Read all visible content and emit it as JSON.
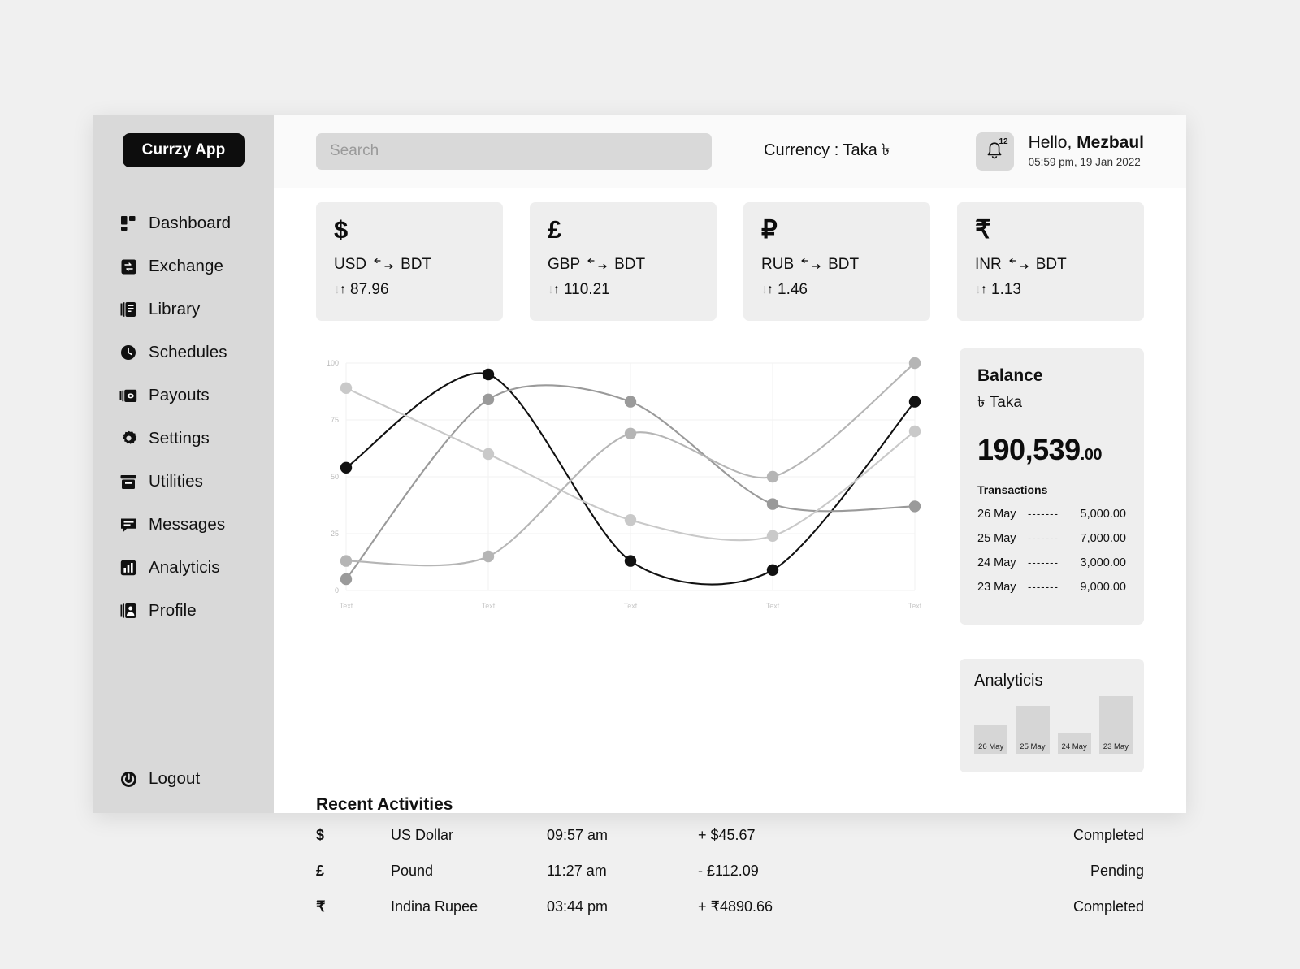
{
  "brand": {
    "name": "Currzy App"
  },
  "sidebar": {
    "items": [
      {
        "label": "Dashboard",
        "icon": "dashboard-icon"
      },
      {
        "label": "Exchange",
        "icon": "exchange-icon"
      },
      {
        "label": "Library",
        "icon": "library-icon"
      },
      {
        "label": "Schedules",
        "icon": "clock-icon"
      },
      {
        "label": "Payouts",
        "icon": "money-icon"
      },
      {
        "label": "Settings",
        "icon": "gear-icon"
      },
      {
        "label": "Utilities",
        "icon": "archive-icon"
      },
      {
        "label": "Messages",
        "icon": "chat-icon"
      },
      {
        "label": "Analyticis",
        "icon": "bar-chart-icon"
      },
      {
        "label": "Profile",
        "icon": "profile-icon"
      }
    ],
    "logout": {
      "label": "Logout",
      "icon": "power-icon"
    }
  },
  "topbar": {
    "search_placeholder": "Search",
    "search_value": "",
    "currency_label": "Currency : Taka ৳",
    "notifications_count": "12",
    "greeting_prefix": "Hello, ",
    "user_name": "Mezbaul",
    "datetime": "05:59 pm, 19 Jan 2022"
  },
  "rate_cards": [
    {
      "symbol": "$",
      "from": "USD",
      "arrow": "↔",
      "to": "BDT",
      "value": "87.96"
    },
    {
      "symbol": "£",
      "from": "GBP",
      "arrow": "↔",
      "to": "BDT",
      "value": "110.21"
    },
    {
      "symbol": "₽",
      "from": "RUB",
      "arrow": "↔",
      "to": "BDT",
      "value": "1.46"
    },
    {
      "symbol": "₹",
      "from": "INR",
      "arrow": "↔",
      "to": "BDT",
      "value": "1.13"
    }
  ],
  "chart_data": {
    "type": "line",
    "title": "",
    "xlabel": "",
    "ylabel": "",
    "ylim": [
      0,
      100
    ],
    "yticks": [
      0,
      25,
      50,
      75,
      100
    ],
    "grid": true,
    "legend": "none",
    "categories": [
      "Text",
      "Text",
      "Text",
      "Text",
      "Text"
    ],
    "series": [
      {
        "name": "series-dark",
        "color": "#111111",
        "values": [
          54,
          95,
          13,
          9,
          83
        ]
      },
      {
        "name": "series-mid-gray",
        "color": "#9a9a9a",
        "values": [
          5,
          84,
          83,
          38,
          37
        ]
      },
      {
        "name": "series-light-gray",
        "color": "#c9c9c9",
        "values": [
          89,
          60,
          31,
          24,
          70
        ]
      },
      {
        "name": "series-pale-gray",
        "color": "#b5b5b5",
        "values": [
          13,
          15,
          69,
          50,
          100
        ]
      }
    ]
  },
  "balance": {
    "title": "Balance",
    "currency_symbol": "৳",
    "currency_name": "Taka",
    "amount_main": "190,539",
    "amount_cents": ".00",
    "transactions_title": "Transactions",
    "dash": "-------",
    "transactions": [
      {
        "date": "26 May",
        "amount": "5,000.00"
      },
      {
        "date": "25 May",
        "amount": "7,000.00"
      },
      {
        "date": "24 May",
        "amount": "3,000.00"
      },
      {
        "date": "23 May",
        "amount": "9,000.00"
      }
    ]
  },
  "activities": {
    "title": "Recent Activities",
    "rows": [
      {
        "symbol": "$",
        "name": "US Dollar",
        "time": "09:57 am",
        "amount": "+ $45.67",
        "status": "Completed"
      },
      {
        "symbol": "£",
        "name": "Pound",
        "time": "11:27 am",
        "amount": "- £112.09",
        "status": "Pending"
      },
      {
        "symbol": "₹",
        "name": "Indina Rupee",
        "time": "03:44 pm",
        "amount": "+ ₹4890.66",
        "status": "Completed"
      }
    ]
  },
  "analytics": {
    "title": "Analyticis",
    "chart_data": {
      "type": "bar",
      "categories": [
        "26 May",
        "25 May",
        "24 May",
        "23 May"
      ],
      "values": [
        42,
        70,
        30,
        84
      ],
      "ylim": [
        0,
        100
      ]
    }
  },
  "colors": {
    "page_bg": "#f0f0f0",
    "sidebar_bg": "#d9d9d9",
    "card_bg": "#eeeeee",
    "accent_dark": "#0d0d0d"
  }
}
